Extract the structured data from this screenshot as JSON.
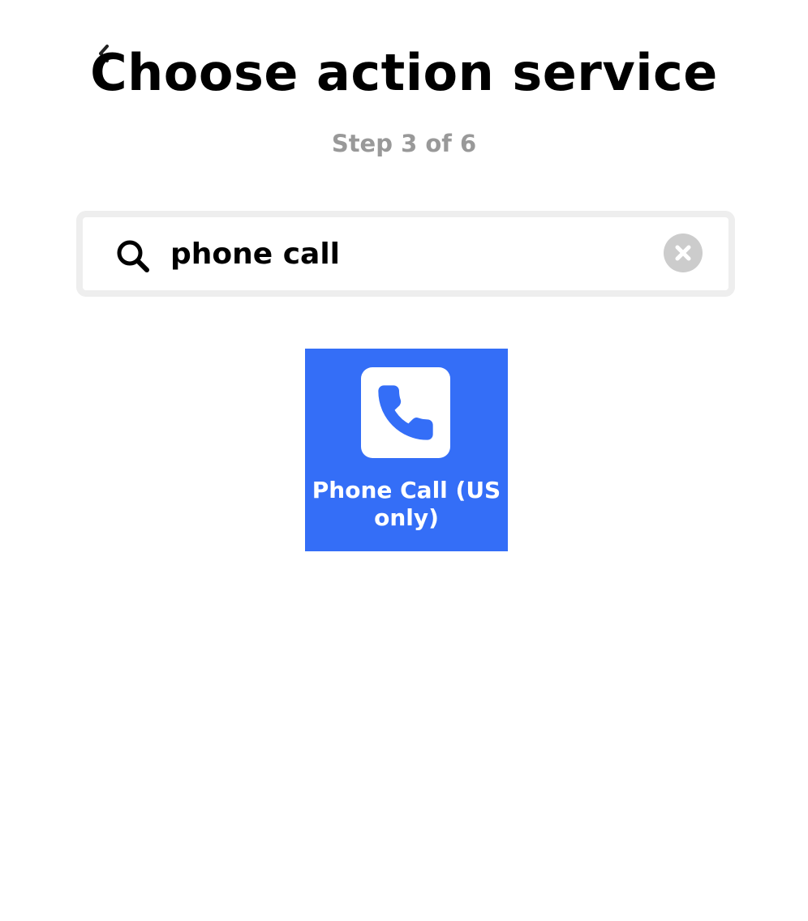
{
  "header": {
    "back_icon": "chevron-left-icon",
    "title": "Choose action service",
    "step": "Step 3 of 6"
  },
  "search": {
    "icon": "search-icon",
    "value": "phone call",
    "clear_icon": "close-icon"
  },
  "results": [
    {
      "name": "Phone Call (US only)",
      "icon": "phone-icon",
      "color": "#346ef7"
    }
  ],
  "colors": {
    "title": "#000000",
    "step": "#999999",
    "search_border": "#eeeeee",
    "clear_button": "#cccccc",
    "tile_text": "#ffffff"
  }
}
